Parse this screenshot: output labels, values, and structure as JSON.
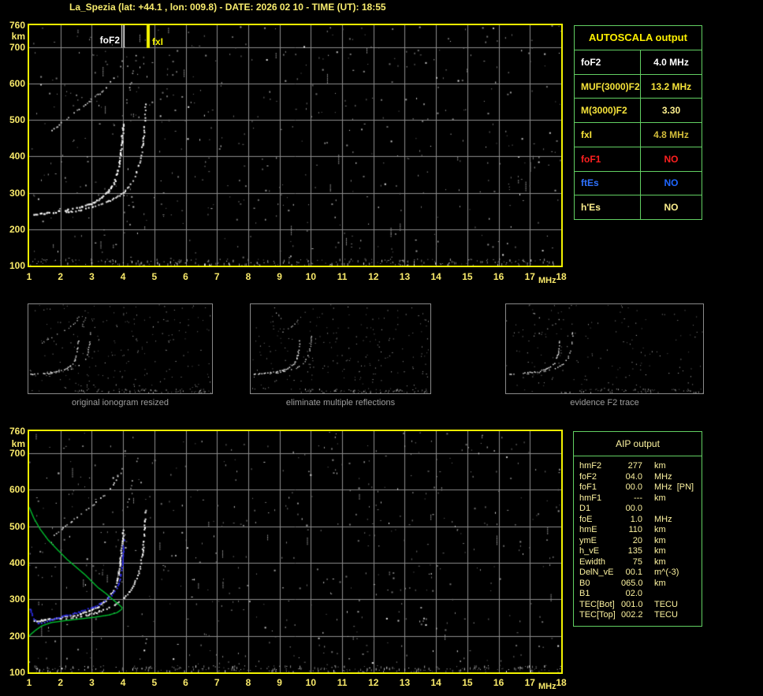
{
  "title": "La_Spezia (lat: +44.1 , lon: 009.8) - DATE: 2026 02 10 - TIME (UT): 18:55",
  "axes": {
    "x_unit": "MHz",
    "y_unit": "km"
  },
  "colors": {
    "background": "#000000",
    "plot_border": "#f2f200",
    "grid": "#8c8c8c",
    "tick_label": "#f8e96a",
    "title": "#f8ec6e",
    "table_border": "#62cf62",
    "autoscala_header": "#fdf000",
    "aip_text": "#fdf3a0",
    "caption": "#9e9e9e",
    "trace": "#ffffff",
    "profile_green": "#00bd2e",
    "restored_blue": "#2a2ae8",
    "marker_foF2": "#ffffff",
    "marker_fxI": "#f2f200"
  },
  "top_plot": {
    "markers": [
      {
        "label": "foF2",
        "freq": 4.0,
        "color": "#ffffff"
      },
      {
        "label": "fxI",
        "freq": 4.8,
        "color": "#f2f200"
      }
    ]
  },
  "autoscala_table": {
    "header": "AUTOSCALA output",
    "rows": [
      {
        "label": "foF2",
        "value": "4.0 MHz",
        "label_color": "#ffffff",
        "value_color": "#ffffff"
      },
      {
        "label": "MUF(3000)F2",
        "value": "13.2 MHz",
        "label_color": "#f6e33a",
        "value_color": "#f6e33a"
      },
      {
        "label": "M(3000)F2",
        "value": "3.30",
        "label_color": "#f6e33a",
        "value_color": "#fcee8d"
      },
      {
        "label": "fxI",
        "value": "4.8 MHz",
        "label_color": "#f6e33a",
        "value_color": "#d2bc3a"
      },
      {
        "label": "foF1",
        "value": "NO",
        "label_color": "#ff2020",
        "value_color": "#ff2020"
      },
      {
        "label": "ftEs",
        "value": "NO",
        "label_color": "#2f72ff",
        "value_color": "#1f66ff"
      },
      {
        "label": "h'Es",
        "value": "NO",
        "label_color": "#fcee8d",
        "value_color": "#fcee8d"
      }
    ]
  },
  "thumbnails": [
    {
      "caption": "original ionogram resized"
    },
    {
      "caption": "eliminate multiple reflections"
    },
    {
      "caption": "evidence F2 trace"
    }
  ],
  "aip_table": {
    "header": "AIP output",
    "rows": [
      {
        "label": "hmF2",
        "value": "277",
        "unit": "km"
      },
      {
        "label": "foF2",
        "value": "04.0",
        "unit": "MHz"
      },
      {
        "label": "foF1",
        "value": "00.0",
        "unit": "MHz  [PN]"
      },
      {
        "label": "hmF1",
        "value": "---",
        "unit": "km"
      },
      {
        "label": "D1",
        "value": "00.0",
        "unit": ""
      },
      {
        "label": "foE",
        "value": "1.0",
        "unit": "MHz"
      },
      {
        "label": "hmE",
        "value": "110",
        "unit": "km"
      },
      {
        "label": "ymE",
        "value": "20",
        "unit": "km"
      },
      {
        "label": "h_vE",
        "value": "135",
        "unit": "km"
      },
      {
        "label": "Ewidth",
        "value": "75",
        "unit": "km"
      },
      {
        "label": "DelN_vE",
        "value": "00.1",
        "unit": "m^(-3)"
      },
      {
        "label": "B0",
        "value": "065.0",
        "unit": "km"
      },
      {
        "label": "B1",
        "value": "02.0",
        "unit": ""
      },
      {
        "label": "TEC[Bot]",
        "value": "001.0",
        "unit": "TECU"
      },
      {
        "label": "TEC[Top]",
        "value": "002.2",
        "unit": "TECU"
      }
    ]
  },
  "chart_data": {
    "type": "scatter",
    "title": "Ionogram with AUTOSCALA scaling and AIP profile fit",
    "xlabel": "MHz",
    "ylabel": "km",
    "xlim": [
      1,
      18
    ],
    "ylim": [
      100,
      760
    ],
    "x_ticks": [
      1,
      2,
      3,
      4,
      5,
      6,
      7,
      8,
      9,
      10,
      11,
      12,
      13,
      14,
      15,
      16,
      17,
      18
    ],
    "y_ticks": [
      760,
      700,
      600,
      500,
      400,
      300,
      200,
      100
    ],
    "markers": [
      {
        "name": "foF2",
        "x": 4.0
      },
      {
        "name": "fxI",
        "x": 4.8
      }
    ],
    "series": [
      {
        "name": "F2 trace O-mode",
        "color": "#ffffff",
        "points": [
          [
            1.15,
            240
          ],
          [
            1.3,
            241
          ],
          [
            1.5,
            243
          ],
          [
            1.8,
            246
          ],
          [
            2.1,
            250
          ],
          [
            2.4,
            255
          ],
          [
            2.7,
            261
          ],
          [
            3.0,
            270
          ],
          [
            3.2,
            279
          ],
          [
            3.4,
            291
          ],
          [
            3.55,
            305
          ],
          [
            3.7,
            323
          ],
          [
            3.8,
            345
          ],
          [
            3.87,
            370
          ],
          [
            3.92,
            400
          ],
          [
            3.96,
            432
          ],
          [
            3.99,
            462
          ],
          [
            4.01,
            487
          ]
        ]
      },
      {
        "name": "F2 trace X-mode",
        "color": "#ffffff",
        "points": [
          [
            2.2,
            246
          ],
          [
            2.5,
            250
          ],
          [
            2.8,
            255
          ],
          [
            3.1,
            262
          ],
          [
            3.4,
            271
          ],
          [
            3.7,
            282
          ],
          [
            3.95,
            296
          ],
          [
            4.15,
            312
          ],
          [
            4.3,
            330
          ],
          [
            4.42,
            352
          ],
          [
            4.52,
            378
          ],
          [
            4.6,
            410
          ],
          [
            4.65,
            443
          ],
          [
            4.69,
            478
          ],
          [
            4.71,
            512
          ],
          [
            4.73,
            548
          ]
        ]
      },
      {
        "name": "second-hop trace",
        "color": "#c8c8c8",
        "points": [
          [
            1.75,
            470
          ],
          [
            2.0,
            488
          ],
          [
            2.25,
            505
          ],
          [
            2.5,
            522
          ],
          [
            2.75,
            538
          ],
          [
            3.0,
            555
          ],
          [
            3.25,
            572
          ],
          [
            3.45,
            588
          ],
          [
            3.62,
            605
          ],
          [
            3.77,
            622
          ],
          [
            3.88,
            638
          ],
          [
            3.96,
            654
          ],
          [
            4.02,
            668
          ]
        ]
      },
      {
        "name": "second-hop X fragments",
        "color": "#b0b0b0",
        "points": [
          [
            4.12,
            548
          ],
          [
            4.18,
            572
          ],
          [
            4.25,
            598
          ],
          [
            4.31,
            622
          ],
          [
            4.37,
            646
          ],
          [
            4.42,
            668
          ],
          [
            4.47,
            690
          ]
        ]
      },
      {
        "name": "AIP electron density profile",
        "color": "#00bd2e",
        "points": [
          [
            1.0,
            552
          ],
          [
            1.15,
            522
          ],
          [
            1.35,
            492
          ],
          [
            1.6,
            463
          ],
          [
            1.9,
            436
          ],
          [
            2.2,
            410
          ],
          [
            2.5,
            388
          ],
          [
            2.8,
            366
          ],
          [
            3.0,
            349
          ],
          [
            3.2,
            332
          ],
          [
            3.45,
            316
          ],
          [
            3.65,
            301
          ],
          [
            3.8,
            290
          ],
          [
            3.9,
            283
          ],
          [
            3.97,
            277
          ],
          [
            3.95,
            272
          ],
          [
            3.8,
            263
          ],
          [
            3.55,
            257
          ],
          [
            3.1,
            251
          ],
          [
            2.6,
            246
          ],
          [
            2.1,
            241
          ],
          [
            1.7,
            236
          ],
          [
            1.4,
            227
          ],
          [
            1.2,
            215
          ],
          [
            1.05,
            204
          ],
          [
            1.0,
            199
          ]
        ]
      },
      {
        "name": "AIP restored trace",
        "color": "#2a2ae8",
        "points": [
          [
            1.05,
            273
          ],
          [
            1.15,
            247
          ],
          [
            1.3,
            233
          ],
          [
            1.5,
            236
          ],
          [
            1.7,
            243
          ],
          [
            1.9,
            248
          ],
          [
            2.1,
            253
          ],
          [
            2.35,
            259
          ],
          [
            2.6,
            265
          ],
          [
            2.85,
            272
          ],
          [
            3.1,
            280
          ],
          [
            3.3,
            289
          ],
          [
            3.5,
            300
          ],
          [
            3.65,
            312
          ],
          [
            3.78,
            327
          ],
          [
            3.88,
            346
          ],
          [
            3.94,
            368
          ],
          [
            3.98,
            394
          ],
          [
            4.0,
            420
          ],
          [
            4.02,
            445
          ],
          [
            4.04,
            467
          ]
        ]
      }
    ]
  }
}
